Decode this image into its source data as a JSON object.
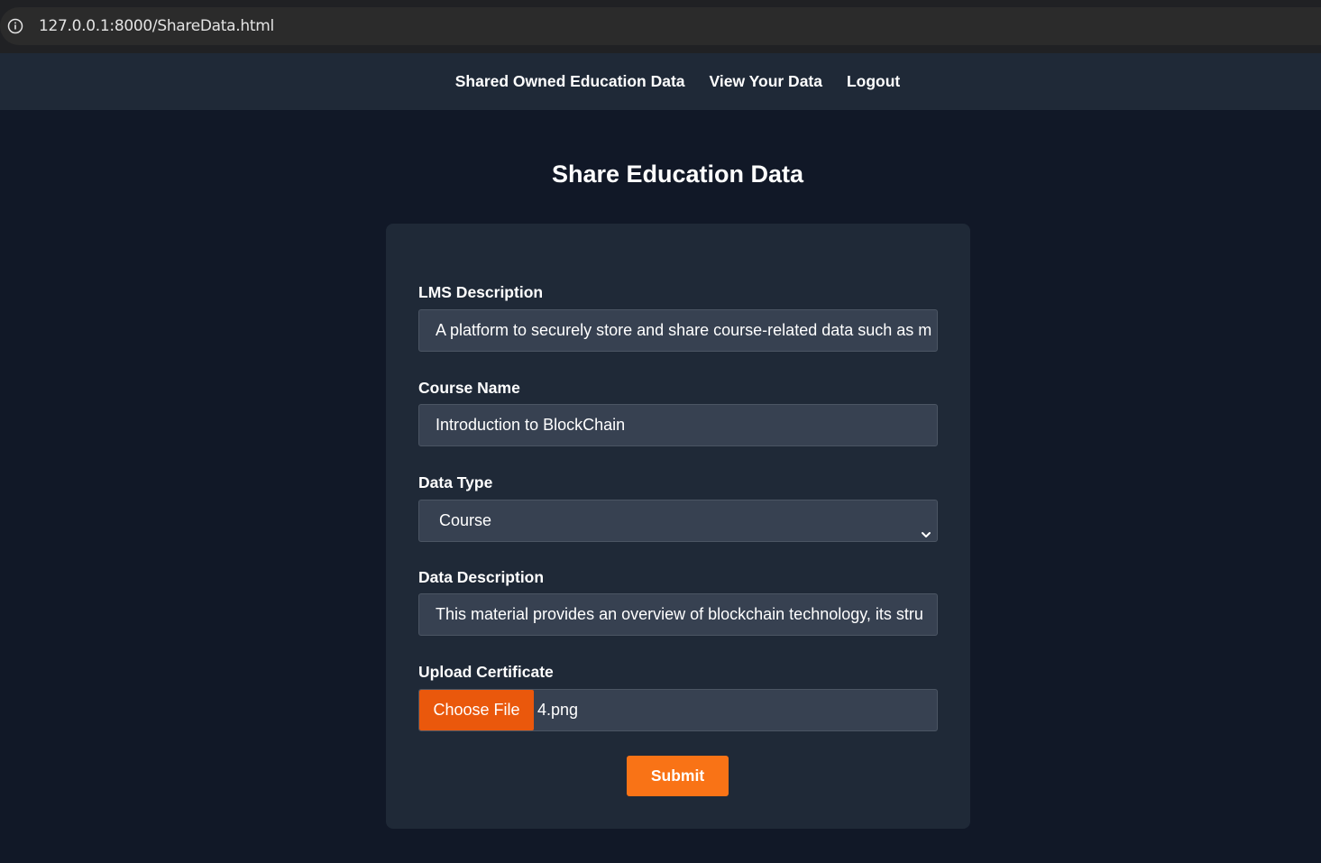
{
  "browser": {
    "url": "127.0.0.1:8000/ShareData.html"
  },
  "nav": {
    "links": [
      "Shared Owned Education Data",
      "View Your Data",
      "Logout"
    ]
  },
  "page": {
    "title": "Share Education Data"
  },
  "form": {
    "lms_description": {
      "label": "LMS Description",
      "value": "A platform to securely store and share course-related data such as m"
    },
    "course_name": {
      "label": "Course Name",
      "value": "Introduction to BlockChain"
    },
    "data_type": {
      "label": "Data Type",
      "selected": "Course"
    },
    "data_description": {
      "label": "Data Description",
      "value": "This material provides an overview of blockchain technology, its stru"
    },
    "upload_certificate": {
      "label": "Upload Certificate",
      "button_label": "Choose File",
      "file_name": "4.png"
    },
    "submit_label": "Submit"
  },
  "colors": {
    "page_bg": "#111827",
    "card_bg": "#1f2937",
    "input_bg": "#374151",
    "accent": "#f97316",
    "file_button": "#ea580c"
  }
}
